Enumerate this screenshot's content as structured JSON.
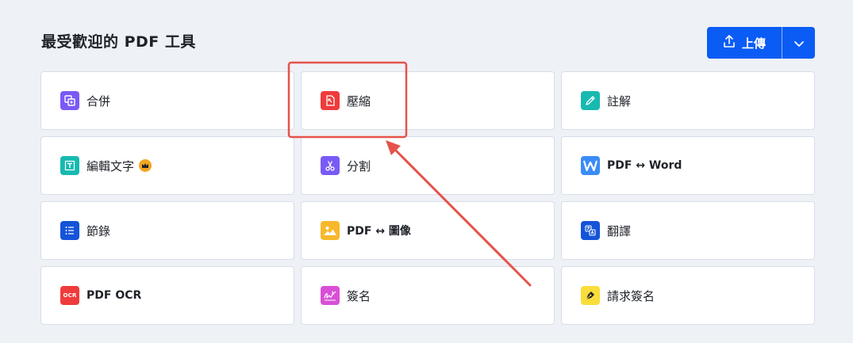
{
  "section": {
    "title": "最受歡迎的 PDF 工具"
  },
  "upload": {
    "label": "上傳"
  },
  "tools": [
    {
      "label": "合併",
      "icon": "merge-icon",
      "color": "#7a5af5"
    },
    {
      "label": "壓縮",
      "icon": "compress-icon",
      "color": "#ef3b3b"
    },
    {
      "label": "註解",
      "icon": "pencil-icon",
      "color": "#18b9b0"
    },
    {
      "label": "編輯文字",
      "icon": "edit-text-icon",
      "color": "#18b9b0"
    },
    {
      "label": "分割",
      "icon": "scissors-icon",
      "color": "#7a5af5"
    },
    {
      "label": "PDF ↔ Word",
      "icon": "word-icon",
      "color": "#3b8cf7"
    },
    {
      "label": "節錄",
      "icon": "list-icon",
      "color": "#1554d9"
    },
    {
      "label": "PDF ↔ 圖像",
      "icon": "image-icon",
      "color": "#f8b82b"
    },
    {
      "label": "翻譯",
      "icon": "translate-icon",
      "color": "#1554d9"
    },
    {
      "label": "PDF OCR",
      "icon": "ocr-icon",
      "color": "#ef3b3b",
      "icon_text": "OCR"
    },
    {
      "label": "簽名",
      "icon": "signature-icon",
      "color": "#d94fd6"
    },
    {
      "label": "請求簽名",
      "icon": "pen-nib-icon",
      "color": "#f9dd3b"
    }
  ],
  "colors": {
    "primary": "#0a5cf5",
    "annotation": "#e5534b",
    "premium": "#f5a623"
  }
}
